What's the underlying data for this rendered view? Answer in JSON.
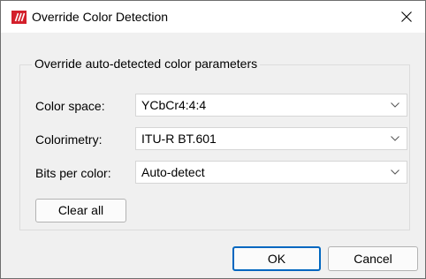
{
  "window": {
    "title": "Override Color Detection",
    "app_icon": "red-slash-logo-icon",
    "close_icon": "close-icon",
    "accent_color": "#0067c0",
    "logo_color": "#d31f2b"
  },
  "group": {
    "legend": "Override auto-detected color parameters",
    "fields": [
      {
        "label": "Color space:",
        "value": "YCbCr4:4:4"
      },
      {
        "label": "Colorimetry:",
        "value": "ITU-R BT.601"
      },
      {
        "label": "Bits per color:",
        "value": "Auto-detect"
      }
    ],
    "clear_label": "Clear all"
  },
  "buttons": {
    "ok_label": "OK",
    "cancel_label": "Cancel"
  }
}
